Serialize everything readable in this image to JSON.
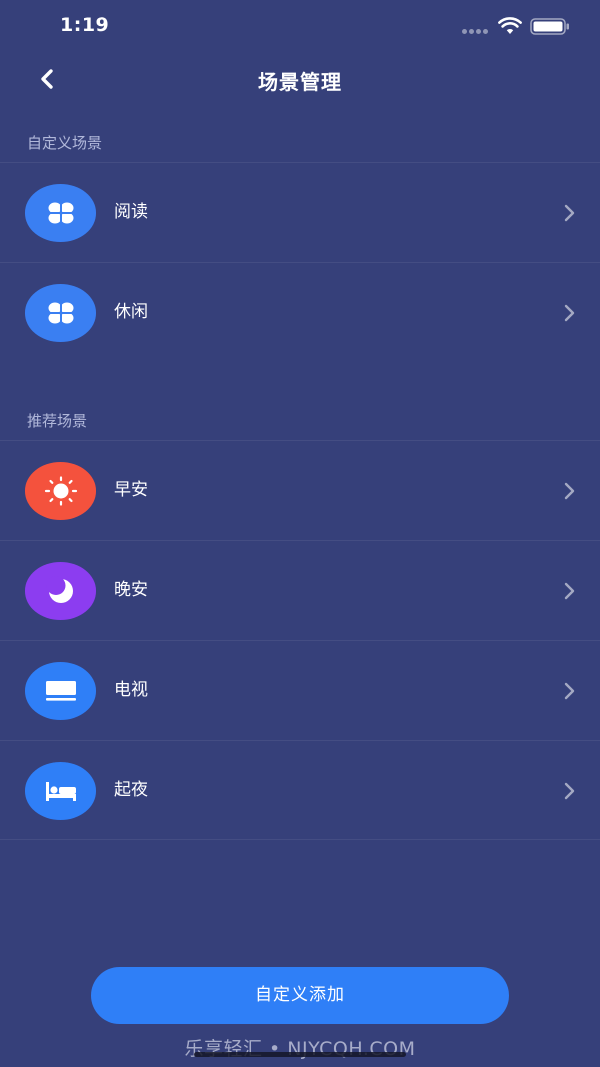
{
  "status_bar": {
    "time": "1:19"
  },
  "nav": {
    "title": "场景管理"
  },
  "sections": {
    "custom": {
      "header": "自定义场景",
      "items": [
        {
          "label": "阅读",
          "icon": "clover-icon",
          "color": "#3a7ff2"
        },
        {
          "label": "休闲",
          "icon": "clover-icon",
          "color": "#3a7ff2"
        }
      ]
    },
    "recommended": {
      "header": "推荐场景",
      "items": [
        {
          "label": "早安",
          "icon": "sun-icon",
          "color": "#f4523d"
        },
        {
          "label": "晚安",
          "icon": "moon-icon",
          "color": "#8c3df0"
        },
        {
          "label": "电视",
          "icon": "tv-icon",
          "color": "#2f7ff7"
        },
        {
          "label": "起夜",
          "icon": "bed-icon",
          "color": "#2f7ff7"
        }
      ]
    }
  },
  "add_button": {
    "label": "自定义添加",
    "color": "#2f7ff7"
  },
  "watermark": {
    "text": "乐享轻汇 • NJYCQH.COM"
  },
  "colors": {
    "background": "#36407a",
    "accent": "#2f7ff7"
  }
}
